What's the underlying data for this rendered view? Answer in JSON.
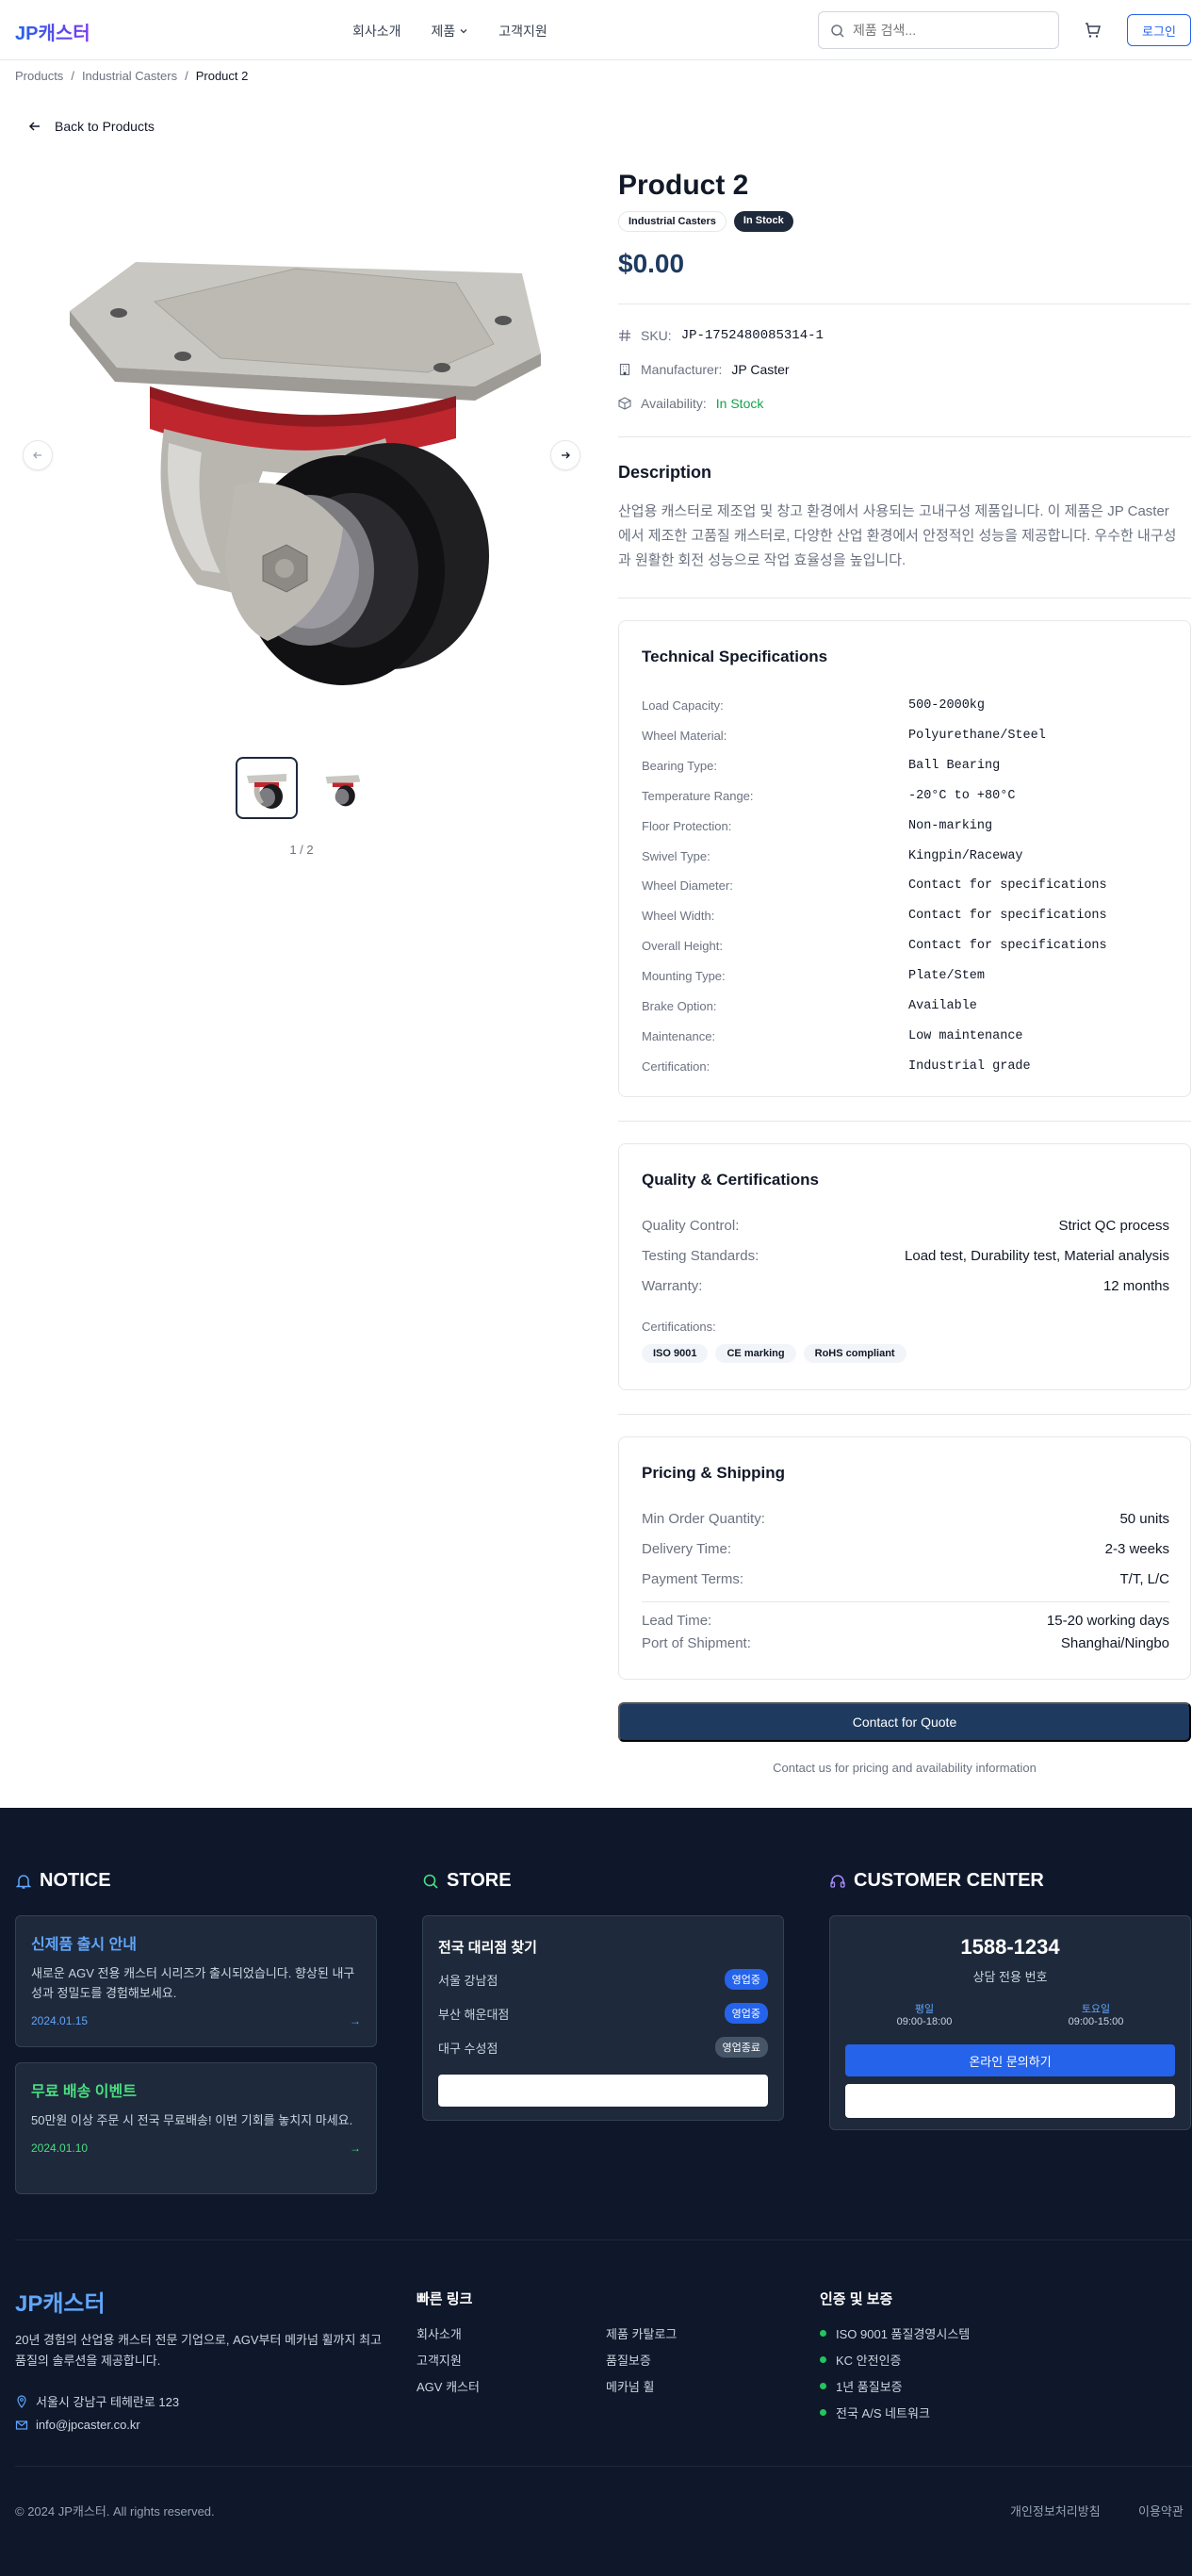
{
  "header": {
    "logo": "JP캐스터",
    "nav": [
      "회사소개",
      "제품",
      "고객지원"
    ],
    "search_placeholder": "제품 검색...",
    "login": "로그인"
  },
  "breadcrumb": [
    "Products",
    "Industrial Casters",
    "Product 2"
  ],
  "back_label": "Back to Products",
  "gallery": {
    "counter": "1 / 2"
  },
  "product": {
    "title": "Product 2",
    "category_badge": "Industrial Casters",
    "stock_badge": "In Stock",
    "price": "$0.00",
    "sku_label": "SKU:",
    "sku": "JP-1752480085314-1",
    "manufacturer_label": "Manufacturer:",
    "manufacturer": "JP Caster",
    "availability_label": "Availability:",
    "availability": "In Stock",
    "description_title": "Description",
    "description": "산업용 캐스터로 제조업 및 창고 환경에서 사용되는 고내구성 제품입니다. 이 제품은 JP Caster에서 제조한 고품질 캐스터로, 다양한 산업 환경에서 안정적인 성능을 제공합니다. 우수한 내구성과 원활한 회전 성능으로 작업 효율성을 높입니다."
  },
  "specs": {
    "title": "Technical Specifications",
    "rows": [
      {
        "k": "Load Capacity:",
        "v": "500-2000kg"
      },
      {
        "k": "Wheel Material:",
        "v": "Polyurethane/Steel"
      },
      {
        "k": "Bearing Type:",
        "v": "Ball Bearing"
      },
      {
        "k": "Temperature Range:",
        "v": "-20°C to +80°C"
      },
      {
        "k": "Floor Protection:",
        "v": "Non-marking"
      },
      {
        "k": "Swivel Type:",
        "v": "Kingpin/Raceway"
      },
      {
        "k": "Wheel Diameter:",
        "v": "Contact for specifications"
      },
      {
        "k": "Wheel Width:",
        "v": "Contact for specifications"
      },
      {
        "k": "Overall Height:",
        "v": "Contact for specifications"
      },
      {
        "k": "Mounting Type:",
        "v": "Plate/Stem"
      },
      {
        "k": "Brake Option:",
        "v": "Available"
      },
      {
        "k": "Maintenance:",
        "v": "Low maintenance"
      },
      {
        "k": "Certification:",
        "v": "Industrial grade"
      }
    ]
  },
  "quality": {
    "title": "Quality & Certifications",
    "rows": [
      {
        "k": "Quality Control:",
        "v": "Strict QC process"
      },
      {
        "k": "Testing Standards:",
        "v": "Load test, Durability test, Material analysis"
      },
      {
        "k": "Warranty:",
        "v": "12 months"
      }
    ],
    "cert_label": "Certifications:",
    "certs": [
      "ISO 9001",
      "CE marking",
      "RoHS compliant"
    ]
  },
  "pricing": {
    "title": "Pricing & Shipping",
    "rows": [
      {
        "k": "Min Order Quantity:",
        "v": "50 units"
      },
      {
        "k": "Delivery Time:",
        "v": "2-3 weeks"
      },
      {
        "k": "Payment Terms:",
        "v": "T/T, L/C"
      },
      {
        "k": "Lead Time:",
        "v": "15-20 working days"
      },
      {
        "k": "Port of Shipment:",
        "v": "Shanghai/Ningbo"
      }
    ]
  },
  "quote_button": "Contact for Quote",
  "quote_note": "Contact us for pricing and availability information",
  "footer": {
    "notice_title": "NOTICE",
    "notices": [
      {
        "title": "신제품 출시 안내",
        "body": "새로운 AGV 전용 캐스터 시리즈가 출시되었습니다. 향상된 내구성과 정밀도를 경험해보세요.",
        "date": "2024.01.15"
      },
      {
        "title": "무료 배송 이벤트",
        "body": "50만원 이상 주문 시 전국 무료배송! 이번 기회를 놓치지 마세요.",
        "date": "2024.01.10"
      }
    ],
    "store_title": "STORE",
    "store_card_title": "전국 대리점 찾기",
    "stores": [
      {
        "name": "서울 강남점",
        "status": "영업중"
      },
      {
        "name": "부산 해운대점",
        "status": "영업중"
      },
      {
        "name": "대구 수성점",
        "status": "영업종료"
      }
    ],
    "cc_title": "CUSTOMER CENTER",
    "cc_phone": "1588-1234",
    "cc_sub": "상담 전용 번호",
    "weekday_label": "평일",
    "weekday_hours": "09:00-18:00",
    "saturday_label": "토요일",
    "saturday_hours": "09:00-15:00",
    "cc_button": "온라인 문의하기",
    "brand": "JP캐스터",
    "brand_text": "20년 경험의 산업용 캐스터 전문 기업으로, AGV부터 메카넘 휠까지 최고 품질의 솔루션을 제공합니다.",
    "address": "서울시 강남구 테헤란로 123",
    "email": "info@jpcaster.co.kr",
    "quick_links_title": "빠른 링크",
    "quick_links": [
      "회사소개",
      "제품 카탈로그",
      "고객지원",
      "품질보증",
      "AGV 캐스터",
      "메카넘 휠"
    ],
    "cert_title": "인증 및 보증",
    "cert_items": [
      "ISO 9001 품질경영시스템",
      "KC 안전인증",
      "1년 품질보증",
      "전국 A/S 네트워크"
    ],
    "copyright": "© 2024 JP캐스터. All rights reserved.",
    "privacy": "개인정보처리방침",
    "terms": "이용약관"
  },
  "colors": {
    "accent": "#2563eb",
    "navy": "#1e3a5f",
    "footer_bg": "#0f172a",
    "in_stock": "#16a34a"
  }
}
